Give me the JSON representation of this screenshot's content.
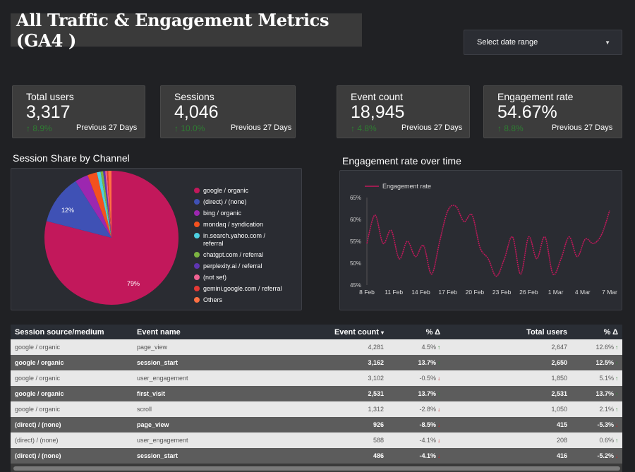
{
  "header": {
    "title": "All Traffic & Engagement Metrics (GA4 )",
    "date_select_label": "Select date range"
  },
  "kpis": [
    {
      "label": "Total users",
      "value": "3,317",
      "delta": "8.9%",
      "prev": "Previous 27 Days"
    },
    {
      "label": "Sessions",
      "value": "4,046",
      "delta": "10.0%",
      "prev": "Previous 27 Days"
    },
    {
      "label": "Event count",
      "value": "18,945",
      "delta": "4.8%",
      "prev": "Previous 27 Days"
    },
    {
      "label": "Engagement rate",
      "value": "54.67%",
      "delta": "8.8%",
      "prev": "Previous 27 Days"
    }
  ],
  "pie": {
    "title": "Session Share by Channel",
    "label_large": "79%",
    "label_second": "12%",
    "legend": [
      {
        "label": "google / organic",
        "color": "#c2185b"
      },
      {
        "label": "(direct) / (none)",
        "color": "#3f51b5"
      },
      {
        "label": "bing / organic",
        "color": "#9c27b0"
      },
      {
        "label": "mondaq / syndication",
        "color": "#f4511e"
      },
      {
        "label": "in.search.yahoo.com / referral",
        "color": "#4dd0e1"
      },
      {
        "label": "chatgpt.com / referral",
        "color": "#7cb342"
      },
      {
        "label": "perplexity.ai / referral",
        "color": "#5e35b1"
      },
      {
        "label": "(not set)",
        "color": "#f06292"
      },
      {
        "label": "gemini.google.com / referral",
        "color": "#e53935"
      },
      {
        "label": "Others",
        "color": "#ff7043"
      }
    ]
  },
  "chart_data": {
    "type": "pie",
    "categories": [
      "google / organic",
      "(direct) / (none)",
      "bing / organic",
      "mondaq / syndication",
      "in.search.yahoo.com / referral",
      "chatgpt.com / referral",
      "perplexity.ai / referral",
      "(not set)",
      "gemini.google.com / referral",
      "Others"
    ],
    "values": [
      79,
      12,
      3.2,
      2.3,
      0.9,
      0.6,
      0.5,
      0.4,
      0.3,
      0.8
    ]
  },
  "line": {
    "title": "Engagement rate over time",
    "series_name": "Engagement rate",
    "y_ticks": [
      "65%",
      "60%",
      "55%",
      "50%",
      "45%"
    ],
    "x_ticks": [
      "8 Feb",
      "11 Feb",
      "14 Feb",
      "17 Feb",
      "20 Feb",
      "23 Feb",
      "26 Feb",
      "1 Mar",
      "4 Mar",
      "7 Mar"
    ],
    "ylim": [
      45,
      65
    ],
    "color": "#c2185b",
    "values": [
      54.5,
      61,
      54.5,
      57.5,
      51,
      55,
      51.5,
      54,
      47.5,
      55,
      62,
      63,
      59.5,
      61,
      53.5,
      51,
      47,
      51,
      56,
      47.5,
      56,
      51,
      56,
      47.5,
      51,
      56,
      51.5,
      55.5,
      54.5,
      56.5,
      62
    ]
  },
  "table": {
    "headers": {
      "source": "Session source/medium",
      "event": "Event name",
      "count": "Event count",
      "count_sort": "▾",
      "count_delta": "% Δ",
      "users": "Total users",
      "users_delta": "% Δ"
    },
    "rows": [
      {
        "source": "google / organic",
        "event": "page_view",
        "count": "4,281",
        "count_delta": "4.5%",
        "count_dir": "up",
        "users": "2,647",
        "users_delta": "12.6%",
        "users_dir": "up"
      },
      {
        "source": "google / organic",
        "event": "session_start",
        "count": "3,162",
        "count_delta": "13.7%",
        "count_dir": "up",
        "users": "2,650",
        "users_delta": "12.5%",
        "users_dir": "up"
      },
      {
        "source": "google / organic",
        "event": "user_engagement",
        "count": "3,102",
        "count_delta": "-0.5%",
        "count_dir": "down",
        "users": "1,850",
        "users_delta": "5.1%",
        "users_dir": "up"
      },
      {
        "source": "google / organic",
        "event": "first_visit",
        "count": "2,531",
        "count_delta": "13.7%",
        "count_dir": "up",
        "users": "2,531",
        "users_delta": "13.7%",
        "users_dir": "up"
      },
      {
        "source": "google / organic",
        "event": "scroll",
        "count": "1,312",
        "count_delta": "-2.8%",
        "count_dir": "down",
        "users": "1,050",
        "users_delta": "2.1%",
        "users_dir": "up"
      },
      {
        "source": "(direct) / (none)",
        "event": "page_view",
        "count": "926",
        "count_delta": "-8.5%",
        "count_dir": "down",
        "users": "415",
        "users_delta": "-5.3%",
        "users_dir": "down"
      },
      {
        "source": "(direct) / (none)",
        "event": "user_engagement",
        "count": "588",
        "count_delta": "-4.1%",
        "count_dir": "down",
        "users": "208",
        "users_delta": "0.6%",
        "users_dir": "up"
      },
      {
        "source": "(direct) / (none)",
        "event": "session_start",
        "count": "486",
        "count_delta": "-4.1%",
        "count_dir": "down",
        "users": "416",
        "users_delta": "-5.2%",
        "users_dir": "down"
      }
    ]
  }
}
